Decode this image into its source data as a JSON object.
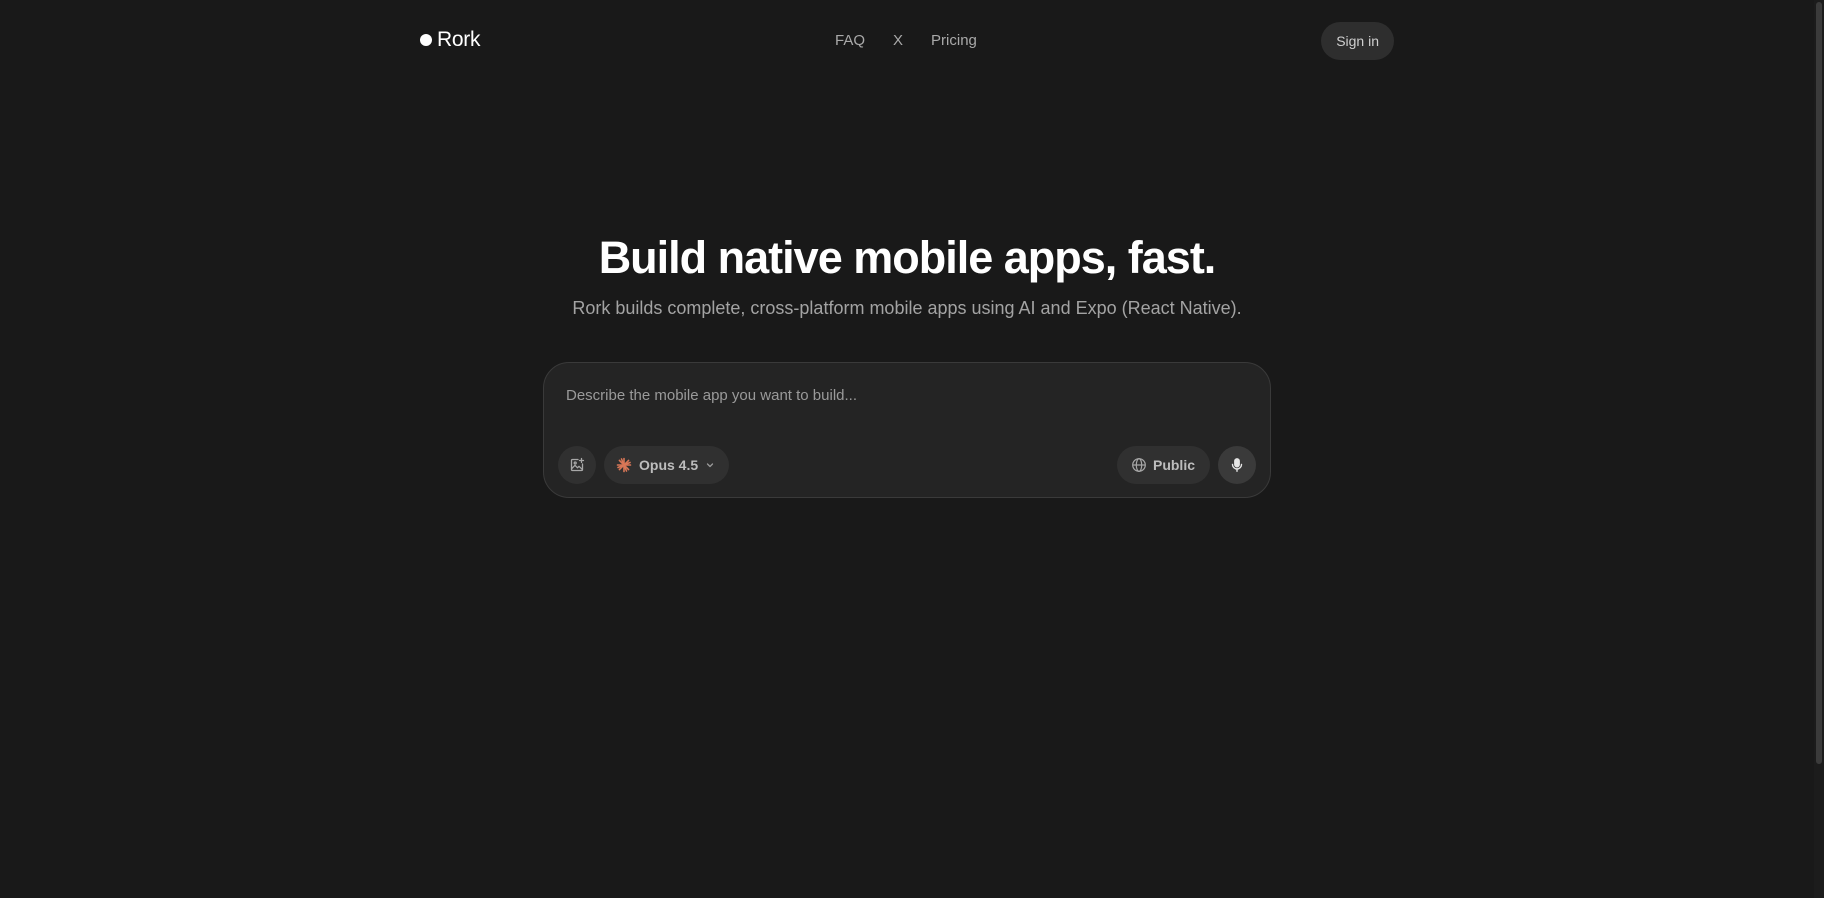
{
  "header": {
    "logo_text": "Rork",
    "nav": [
      {
        "label": "FAQ"
      },
      {
        "label": "X"
      },
      {
        "label": "Pricing"
      }
    ],
    "signin_label": "Sign in"
  },
  "hero": {
    "title": "Build native mobile apps, fast.",
    "subtitle": "Rork builds complete, cross-platform mobile apps using AI and Expo (React Native)."
  },
  "prompt": {
    "placeholder": "Describe the mobile app you want to build...",
    "value": "",
    "model_label": "Opus 4.5",
    "visibility_label": "Public",
    "icons": {
      "attach": "image-add-icon",
      "model": "anthropic-spark-icon",
      "chevron": "chevron-down-icon",
      "globe": "globe-icon",
      "mic": "microphone-icon"
    }
  },
  "colors": {
    "background": "#191919",
    "card": "#242424",
    "pill": "#303030",
    "model_accent": "#d97757",
    "text_primary": "#ffffff",
    "text_muted": "#a3a3a3"
  }
}
